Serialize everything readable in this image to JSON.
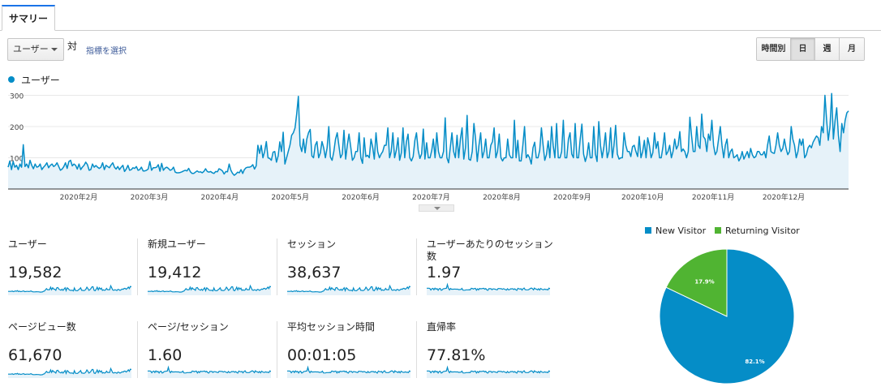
{
  "tab": {
    "label": "サマリー"
  },
  "controls": {
    "metric_select": "ユーザー",
    "vs_label": "対",
    "choose_metric": "指標を選択",
    "periods": {
      "hourly": "時間別",
      "day": "日",
      "week": "週",
      "month": "月",
      "active": "日"
    }
  },
  "colors": {
    "series": "#058dc7",
    "new_visitor": "#058dc7",
    "returning_visitor": "#50b432"
  },
  "chart_data": [
    {
      "type": "area",
      "series": [
        {
          "name": "ユーザー",
          "values": [
            70,
            90,
            62,
            88,
            70,
            76,
            62,
            80,
            70,
            142,
            72,
            80,
            68,
            92,
            76,
            65,
            80,
            70,
            72,
            80,
            62,
            70,
            76,
            84,
            68,
            76,
            80,
            72,
            76,
            84,
            72,
            60,
            64,
            72,
            84,
            66,
            88,
            92,
            74,
            80,
            76,
            64,
            80,
            62,
            70,
            76,
            86,
            78,
            60,
            62,
            80,
            70,
            75,
            70,
            66,
            70,
            84,
            62,
            76,
            72,
            68,
            77,
            84,
            70,
            64,
            72,
            62,
            70,
            76,
            56,
            64,
            76,
            60,
            62,
            68,
            66,
            72,
            60,
            62,
            70,
            58,
            58,
            60,
            64,
            88,
            60,
            68,
            68,
            70,
            78,
            57,
            82,
            60,
            67,
            70,
            66,
            60,
            62,
            70,
            54,
            52,
            52,
            53,
            55,
            58,
            60,
            58,
            66,
            55,
            50,
            50,
            54,
            58,
            54,
            55,
            52,
            56,
            65,
            56,
            54,
            56,
            52,
            50,
            56,
            55,
            65,
            62,
            58,
            48,
            56,
            55,
            80,
            60,
            50,
            44,
            48,
            54,
            52,
            62,
            50,
            62,
            68,
            70,
            70,
            72,
            78,
            64,
            74,
            140,
            114,
            140,
            100,
            120,
            152,
            100,
            98,
            92,
            118,
            120,
            86,
            106,
            151,
            120,
            182,
            80,
            100,
            120,
            140,
            172,
            180,
            196,
            240,
            297,
            140,
            120,
            160,
            116,
            160,
            180,
            191,
            106,
            100,
            140,
            152,
            100,
            116,
            152,
            132,
            100,
            132,
            200,
            102,
            92,
            120,
            160,
            180,
            140,
            100,
            112,
            188,
            96,
            140,
            176,
            136,
            92,
            100,
            120,
            120,
            180,
            100,
            82,
            164,
            104,
            108,
            100,
            160,
            136,
            96,
            180,
            120,
            100,
            112,
            120,
            140,
            140,
            196,
            100,
            120,
            180,
            100,
            124,
            164,
            92,
            116,
            196,
            100,
            152,
            176,
            100,
            90,
            104,
            156,
            180,
            124,
            98,
            112,
            192,
            96,
            148,
            100,
            100,
            124,
            160,
            100,
            180,
            120,
            100,
            100,
            120,
            228,
            100,
            84,
            132,
            180,
            120,
            100,
            172,
            100,
            160,
            196,
            96,
            132,
            236,
            96,
            92,
            120,
            210,
            162,
            88,
            140,
            180,
            100,
            120,
            160,
            100,
            100,
            140,
            152,
            196,
            100,
            120,
            176,
            100,
            90,
            100,
            100,
            160,
            110,
            100,
            100,
            220,
            100,
            156,
            90,
            90,
            140,
            200,
            100,
            110,
            100,
            80,
            132,
            150,
            100,
            100,
            124,
            196,
            140,
            92,
            110,
            154,
            100,
            200,
            140,
            100,
            210,
            100,
            100,
            120,
            220,
            100,
            100,
            160,
            180,
            112,
            100,
            210,
            100,
            100,
            160,
            208,
            112,
            88,
            108,
            148,
            100,
            100,
            200,
            112,
            88,
            216,
            140,
            100,
            136,
            180,
            100,
            120,
            196,
            100,
            140,
            204,
            112,
            96,
            100,
            100,
            180,
            140,
            120,
            120,
            104,
            136,
            140,
            120,
            104,
            168,
            100,
            120,
            156,
            100,
            164,
            140,
            100,
            116,
            180,
            130,
            152,
            100,
            100,
            136,
            180,
            110,
            120,
            140,
            100,
            120,
            160,
            128,
            140,
            184,
            120,
            128,
            120,
            100,
            120,
            230,
            170,
            120,
            120,
            200,
            140,
            130,
            240,
            168,
            160,
            120,
            176,
            156,
            220,
            140,
            110,
            120,
            160,
            200,
            140,
            100,
            140,
            160,
            100,
            120,
            128,
            100,
            104,
            110,
            90,
            100,
            120,
            96,
            108,
            120,
            100,
            130,
            110,
            100,
            104,
            120,
            120,
            110,
            110,
            120,
            100,
            140,
            170,
            120,
            116,
            114,
            140,
            180,
            140,
            120,
            130,
            160,
            130,
            110,
            120,
            200,
            160,
            140,
            100,
            120,
            160,
            140,
            160,
            100,
            110,
            132,
            140,
            132,
            150,
            160,
            170,
            164,
            140,
            200,
            180,
            300,
            220,
            156,
            200,
            306,
            160,
            220,
            260,
            172,
            120,
            210,
            180,
            220,
            244,
            250
          ]
        }
      ],
      "xlabels": [
        "2020年2月",
        "2020年3月",
        "2020年4月",
        "2020年5月",
        "2020年6月",
        "2020年7月",
        "2020年8月",
        "2020年9月",
        "2020年10月",
        "2020年11月",
        "2020年12月"
      ],
      "yticks": [
        100,
        200,
        300
      ],
      "ylim": [
        0,
        330
      ],
      "grid": true
    },
    {
      "type": "pie",
      "categories": [
        "New Visitor",
        "Returning Visitor"
      ],
      "values": [
        82.1,
        17.9
      ],
      "labels": [
        "82.1%",
        "17.9%"
      ]
    }
  ],
  "scorecards": [
    {
      "label": "ユーザー",
      "value": "19,582"
    },
    {
      "label": "新規ユーザー",
      "value": "19,412"
    },
    {
      "label": "セッション",
      "value": "38,637"
    },
    {
      "label": "ユーザーあたりのセッション数",
      "value": "1.97"
    },
    {
      "label": "ページビュー数",
      "value": "61,670"
    },
    {
      "label": "ページ/セッション",
      "value": "1.60"
    },
    {
      "label": "平均セッション時間",
      "value": "00:01:05"
    },
    {
      "label": "直帰率",
      "value": "77.81%"
    }
  ]
}
